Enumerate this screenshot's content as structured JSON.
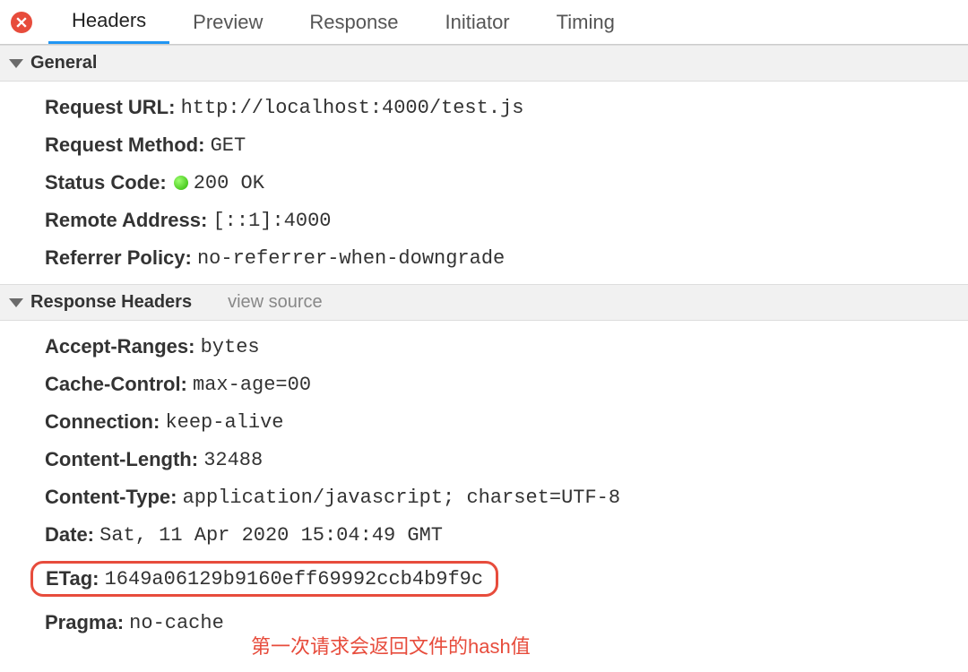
{
  "tabs": {
    "headers": "Headers",
    "preview": "Preview",
    "response": "Response",
    "initiator": "Initiator",
    "timing": "Timing"
  },
  "general": {
    "title": "General",
    "requestUrl": {
      "label": "Request URL:",
      "value": "http://localhost:4000/test.js"
    },
    "requestMethod": {
      "label": "Request Method:",
      "value": "GET"
    },
    "statusCode": {
      "label": "Status Code:",
      "value": "200 OK"
    },
    "remoteAddress": {
      "label": "Remote Address:",
      "value": "[::1]:4000"
    },
    "referrerPolicy": {
      "label": "Referrer Policy:",
      "value": "no-referrer-when-downgrade"
    }
  },
  "responseHeaders": {
    "title": "Response Headers",
    "viewSource": "view source",
    "acceptRanges": {
      "label": "Accept-Ranges:",
      "value": "bytes"
    },
    "cacheControl": {
      "label": "Cache-Control:",
      "value": "max-age=00"
    },
    "connection": {
      "label": "Connection:",
      "value": "keep-alive"
    },
    "contentLength": {
      "label": "Content-Length:",
      "value": "32488"
    },
    "contentType": {
      "label": "Content-Type:",
      "value": "application/javascript; charset=UTF-8"
    },
    "date": {
      "label": "Date:",
      "value": "Sat, 11 Apr 2020 15:04:49 GMT"
    },
    "etag": {
      "label": "ETag:",
      "value": "1649a06129b9160eff69992ccb4b9f9c"
    },
    "pragma": {
      "label": "Pragma:",
      "value": "no-cache"
    }
  },
  "annotation": "第一次请求会返回文件的hash值"
}
